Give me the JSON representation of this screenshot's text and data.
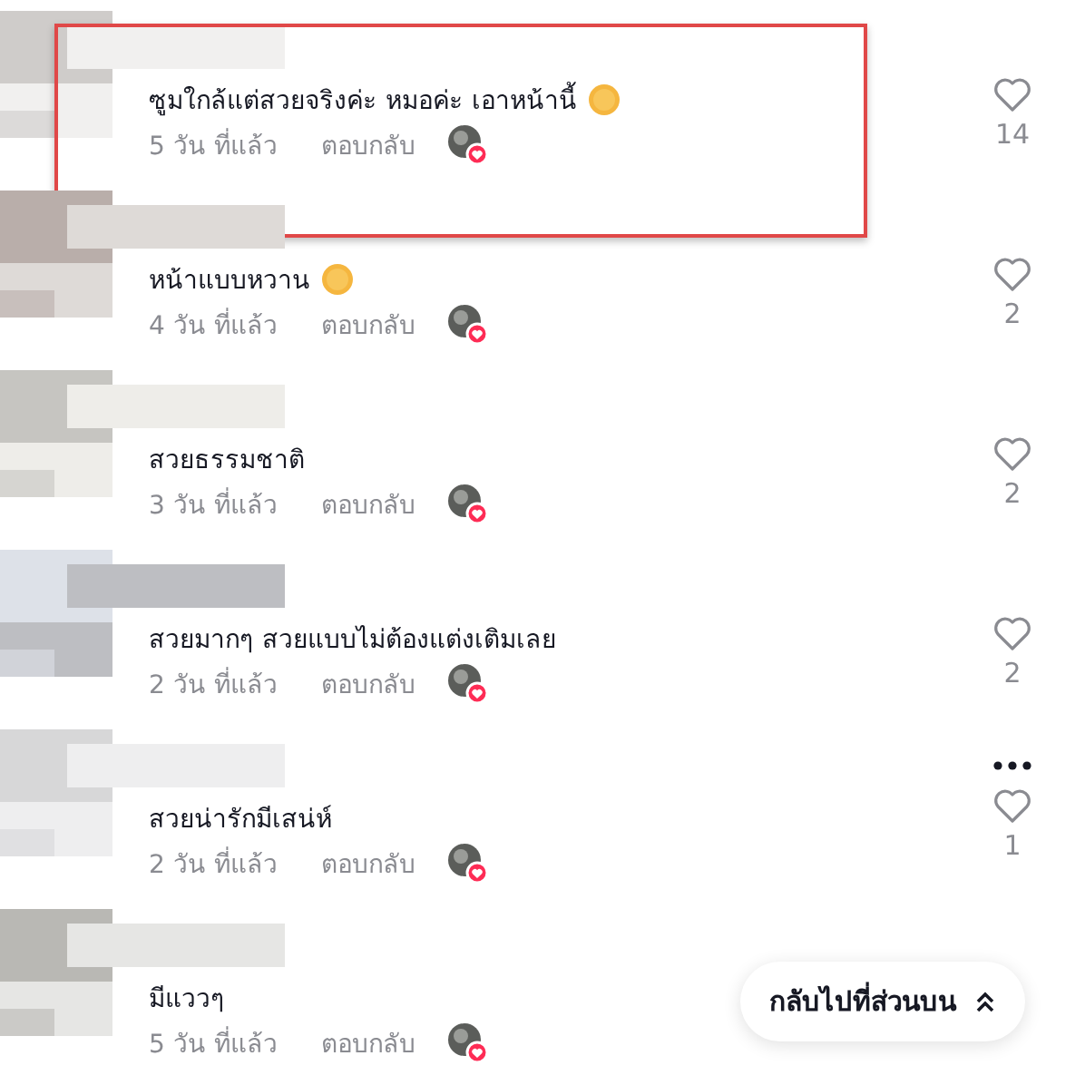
{
  "comments": [
    {
      "text": "ซูมใกล้แต่สวยจริงค่ะ หมอค่ะ เอาหน้านี้",
      "emoji": true,
      "time": "5 วัน ที่แล้ว",
      "reply": "ตอบกลับ",
      "creator_liked": true,
      "likes": "14",
      "menu_shown": false,
      "highlighted": true
    },
    {
      "text": "หน้าแบบหวาน",
      "emoji": true,
      "time": "4 วัน ที่แล้ว",
      "reply": "ตอบกลับ",
      "creator_liked": true,
      "likes": "2",
      "menu_shown": false,
      "highlighted": false
    },
    {
      "text": "สวยธรรมชาติ",
      "emoji": false,
      "time": "3 วัน ที่แล้ว",
      "reply": "ตอบกลับ",
      "creator_liked": true,
      "likes": "2",
      "menu_shown": false,
      "highlighted": false
    },
    {
      "text": "สวยมากๆ สวยแบบไม่ต้องแต่งเติมเลย",
      "emoji": false,
      "time": "2 วัน ที่แล้ว",
      "reply": "ตอบกลับ",
      "creator_liked": true,
      "likes": "2",
      "menu_shown": false,
      "highlighted": false
    },
    {
      "text": "สวยน่ารักมีเสน่ห์",
      "emoji": false,
      "time": "2 วัน ที่แล้ว",
      "reply": "ตอบกลับ",
      "creator_liked": true,
      "likes": "1",
      "menu_shown": true,
      "highlighted": false
    },
    {
      "text": "มีแววๆ",
      "emoji": false,
      "time": "5 วัน ที่แล้ว",
      "reply": "ตอบกลับ",
      "creator_liked": true,
      "menu_shown": false,
      "highlighted": false
    }
  ],
  "back_to_top": {
    "label": "กลับไปที่ส่วนบน"
  }
}
